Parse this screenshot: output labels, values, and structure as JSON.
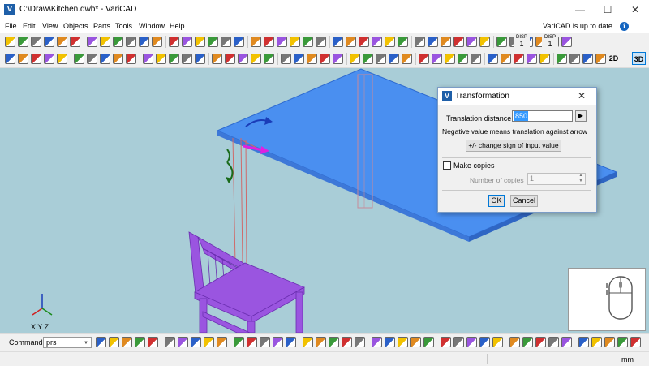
{
  "window": {
    "title": "C:\\Draw\\Kitchen.dwb* - VariCAD",
    "app_icon": "varicad-logo-icon"
  },
  "menu": {
    "items": [
      "File",
      "Edit",
      "View",
      "Objects",
      "Parts",
      "Tools",
      "Window",
      "Help"
    ],
    "update_status": "VariCAD is up to date"
  },
  "toolbar": {
    "disp_label_a": "DISP",
    "disp_value_a": "1",
    "disp_label_b": "DISP",
    "disp_value_b": "1",
    "btn_2d": "2D",
    "btn_3d": "3D"
  },
  "dialog": {
    "title": "Transformation",
    "distance_label": "Translation distance:",
    "distance_value": "850",
    "hint": "Negative value means translation against arrow",
    "change_sign_label": "+/- change sign of input value",
    "make_copies_label": "Make copies",
    "make_copies_checked": false,
    "num_copies_label": "Number of copies",
    "num_copies_value": "1",
    "ok_label": "OK",
    "cancel_label": "Cancel"
  },
  "viewport": {
    "axes_label": "X Y Z",
    "background": "#a9cdd7"
  },
  "command": {
    "label": "Command:",
    "value": "prs"
  },
  "status": {
    "units": "mm"
  },
  "colors": {
    "tabletop": "#4a8ff0",
    "chair": "#9a55e0",
    "dialog_accent": "#0078d7"
  }
}
